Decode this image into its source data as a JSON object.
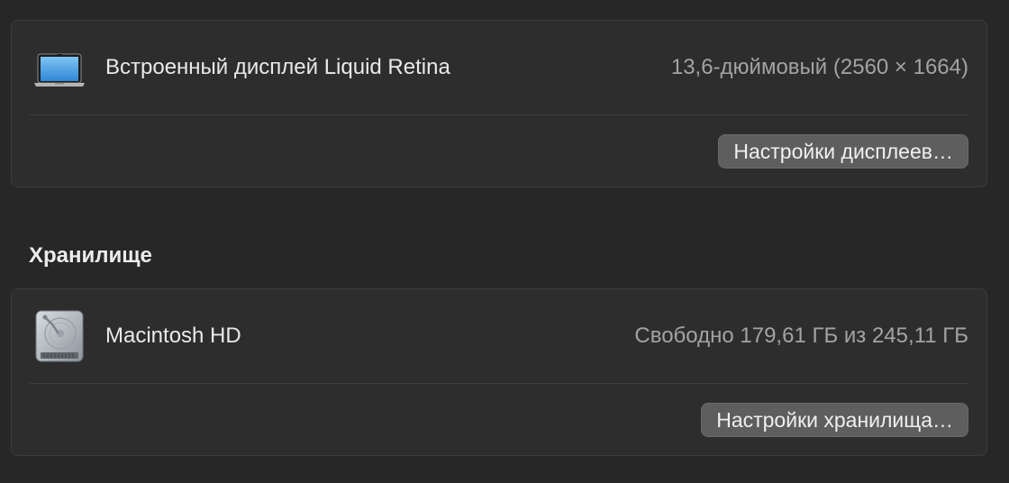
{
  "display": {
    "title": "Встроенный дисплей Liquid Retina",
    "value": "13,6-дюймовый (2560 × 1664)",
    "settings_button": "Настройки дисплеев…",
    "icon": "laptop-icon"
  },
  "storage": {
    "heading": "Хранилище",
    "title": "Macintosh HD",
    "value": "Свободно 179,61 ГБ из 245,11 ГБ",
    "settings_button": "Настройки хранилища…",
    "icon": "hard-drive-icon"
  },
  "colors": {
    "background": "#272727",
    "panel": "#2d2d2d",
    "button": "#5e5e5e",
    "secondary_text": "#a3a3a3"
  }
}
